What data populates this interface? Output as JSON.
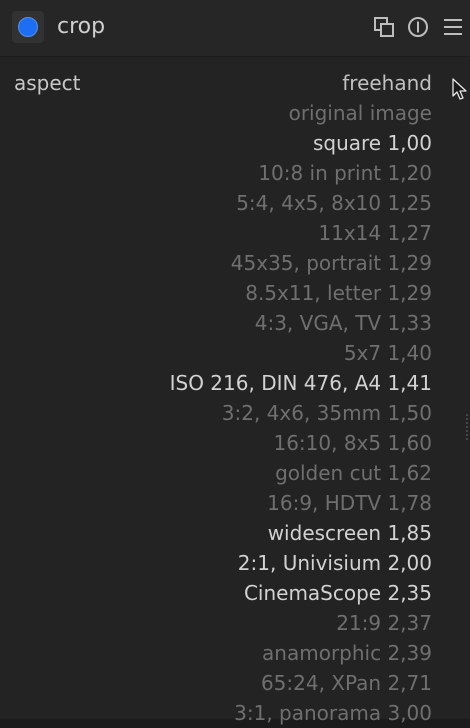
{
  "module": {
    "title": "crop",
    "icon": "crop-module-icon",
    "accent_color": "#1c6ff2"
  },
  "header_buttons": [
    {
      "icon": "multi-instance-icon"
    },
    {
      "icon": "reset-icon"
    },
    {
      "icon": "presets-menu-icon"
    }
  ],
  "aspect": {
    "label": "aspect",
    "selected_index": 0,
    "options": [
      {
        "text": "freehand",
        "style": "selected"
      },
      {
        "text": "original image",
        "style": "dim"
      },
      {
        "text": "square  1,00",
        "style": "strong"
      },
      {
        "text": "10:8 in print  1,20",
        "style": "dim"
      },
      {
        "text": "5:4, 4x5, 8x10  1,25",
        "style": "dim"
      },
      {
        "text": "11x14  1,27",
        "style": "dim"
      },
      {
        "text": "45x35, portrait  1,29",
        "style": "dim"
      },
      {
        "text": "8.5x11, letter  1,29",
        "style": "dim"
      },
      {
        "text": "4:3, VGA, TV  1,33",
        "style": "dim"
      },
      {
        "text": "5x7  1,40",
        "style": "dim"
      },
      {
        "text": "ISO 216, DIN 476, A4  1,41",
        "style": "strong"
      },
      {
        "text": "3:2, 4x6, 35mm  1,50",
        "style": "dim"
      },
      {
        "text": "16:10, 8x5  1,60",
        "style": "dim"
      },
      {
        "text": "golden cut  1,62",
        "style": "dim"
      },
      {
        "text": "16:9, HDTV  1,78",
        "style": "dim"
      },
      {
        "text": "widescreen  1,85",
        "style": "strong"
      },
      {
        "text": "2:1, Univisium  2,00",
        "style": "strong"
      },
      {
        "text": "CinemaScope  2,35",
        "style": "strong"
      },
      {
        "text": "21:9  2,37",
        "style": "dim"
      },
      {
        "text": "anamorphic  2,39",
        "style": "dim"
      },
      {
        "text": "65:24, XPan  2,71",
        "style": "dim"
      },
      {
        "text": "3:1, panorama  3,00",
        "style": "dim"
      }
    ]
  }
}
